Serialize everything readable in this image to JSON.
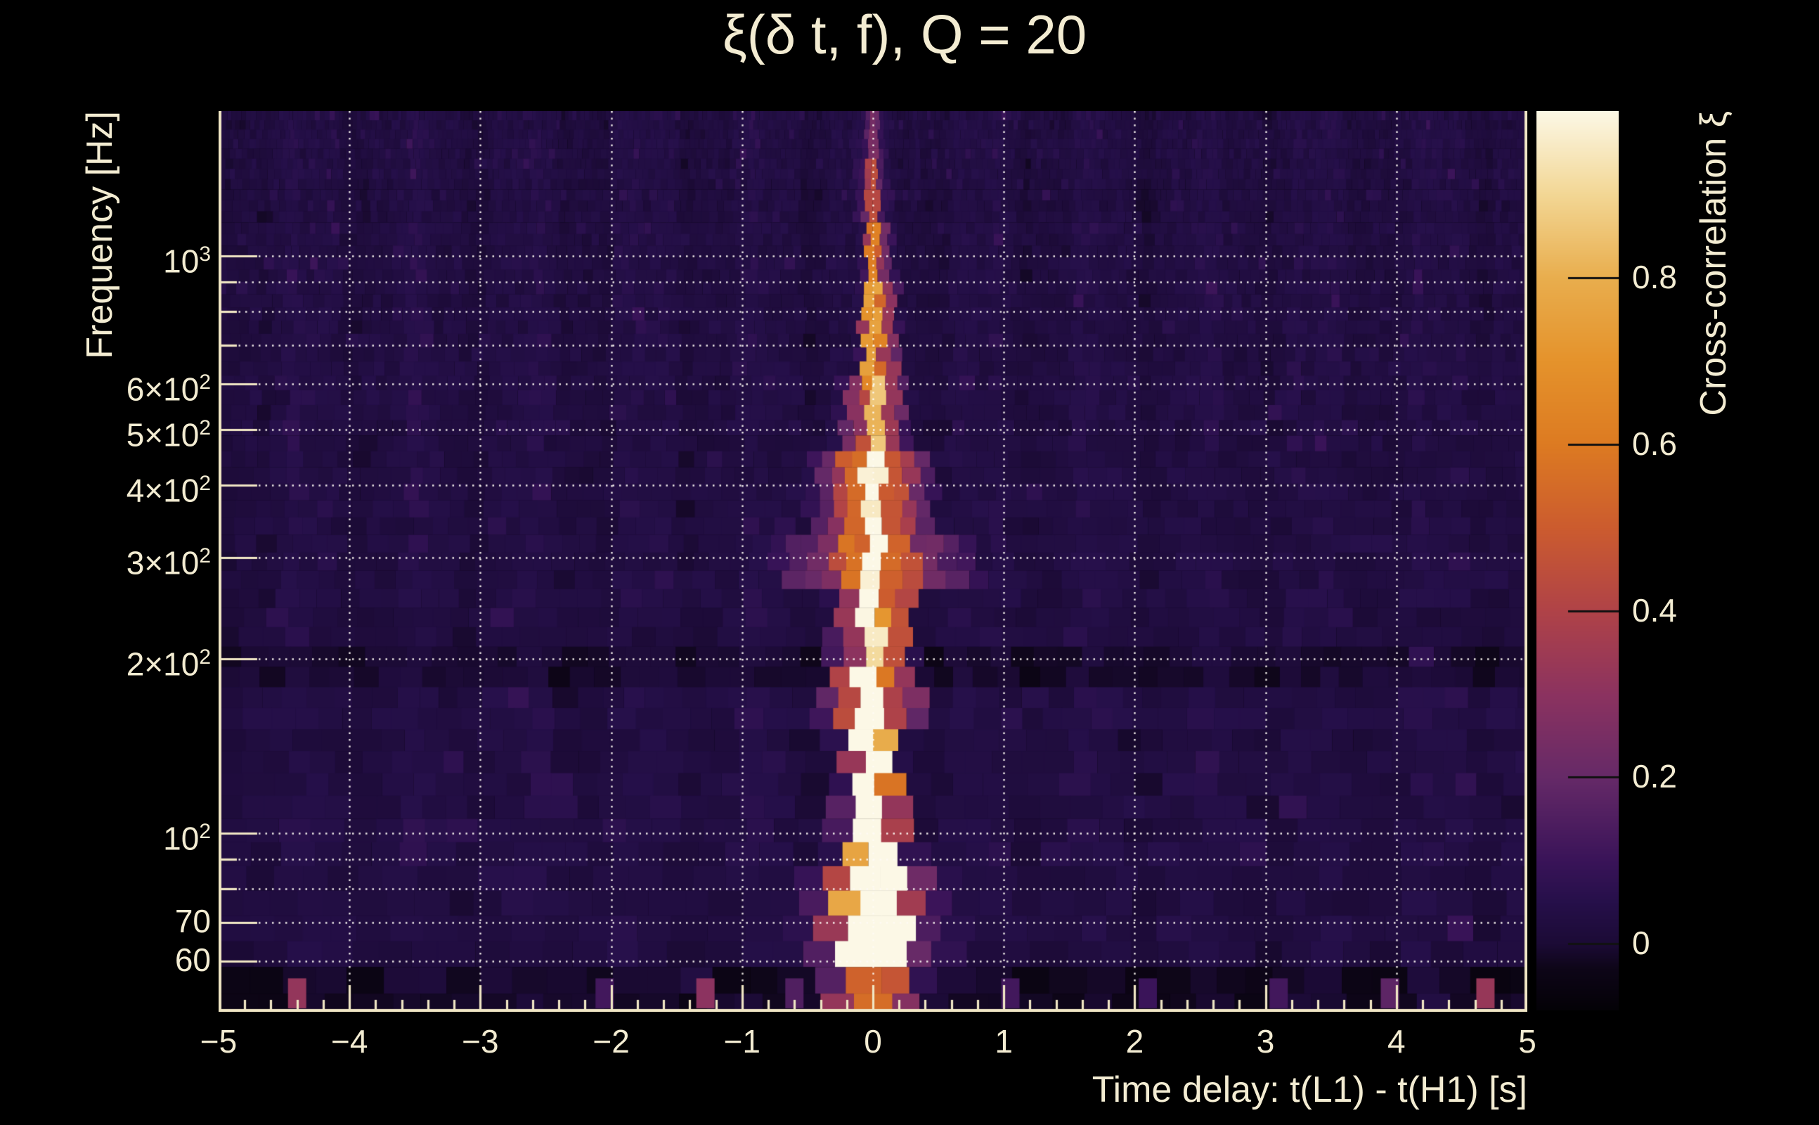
{
  "chart_data": {
    "type": "heatmap",
    "title": "ξ(δ t, f), Q = 20",
    "xlabel": "Time delay: t(L1) - t(H1) [s]",
    "ylabel": "Frequency [Hz]",
    "x_axis": {
      "min": -5,
      "max": 5,
      "major_ticks": [
        -5,
        -4,
        -3,
        -2,
        -1,
        0,
        1,
        2,
        3,
        4,
        5
      ],
      "major_tick_labels": [
        "−5",
        "−4",
        "−3",
        "−2",
        "−1",
        "0",
        "1",
        "2",
        "3",
        "4",
        "5"
      ],
      "minor_tick_step": 0.2,
      "gridlines": [
        -5,
        -4,
        -3,
        -2,
        -1,
        0,
        1,
        2,
        3,
        4,
        5
      ]
    },
    "y_axis": {
      "scale": "log",
      "min_hz": 49,
      "max_hz": 1780,
      "gridlines_hz": [
        1000,
        900,
        800,
        700,
        600,
        500,
        400,
        300,
        200,
        100,
        90,
        80,
        70,
        60
      ],
      "labeled_ticks_hz": [
        1000,
        600,
        500,
        400,
        300,
        200,
        100,
        70,
        60
      ],
      "tick_labels": [
        {
          "hz": 1000,
          "mantissa": "10",
          "exponent": "3"
        },
        {
          "hz": 600,
          "mantissa": "6×10",
          "exponent": "2"
        },
        {
          "hz": 500,
          "mantissa": "5×10",
          "exponent": "2"
        },
        {
          "hz": 400,
          "mantissa": "4×10",
          "exponent": "2"
        },
        {
          "hz": 300,
          "mantissa": "3×10",
          "exponent": "2"
        },
        {
          "hz": 200,
          "mantissa": "2×10",
          "exponent": "2"
        },
        {
          "hz": 100,
          "mantissa": "10",
          "exponent": "2"
        },
        {
          "hz": 70,
          "mantissa": "70",
          "exponent": ""
        },
        {
          "hz": 60,
          "mantissa": "60",
          "exponent": ""
        }
      ]
    },
    "colorbar": {
      "label": "Cross-correlation ξ",
      "vmin": -0.08,
      "vmax": 1.0,
      "ticks": [
        {
          "value": 0.8,
          "label": "0.8"
        },
        {
          "value": 0.6,
          "label": "0.6"
        },
        {
          "value": 0.4,
          "label": "0.4"
        },
        {
          "value": 0.2,
          "label": "0.2"
        },
        {
          "value": 0.0,
          "label": "0"
        }
      ]
    },
    "palette": [
      {
        "v": -0.08,
        "c": "#040207"
      },
      {
        "v": -0.03,
        "c": "#0e0618"
      },
      {
        "v": 0.0,
        "c": "#1c0b36"
      },
      {
        "v": 0.05,
        "c": "#26104a"
      },
      {
        "v": 0.1,
        "c": "#3a1459"
      },
      {
        "v": 0.2,
        "c": "#662a68"
      },
      {
        "v": 0.3,
        "c": "#8c3360"
      },
      {
        "v": 0.4,
        "c": "#b04348"
      },
      {
        "v": 0.5,
        "c": "#cc5c2f"
      },
      {
        "v": 0.6,
        "c": "#dd7b22"
      },
      {
        "v": 0.7,
        "c": "#e5932c"
      },
      {
        "v": 0.8,
        "c": "#e9ae4e"
      },
      {
        "v": 0.9,
        "c": "#f3d795"
      },
      {
        "v": 1.0,
        "c": "#fcf8e6"
      }
    ],
    "signal": {
      "peak_delay_s": 0.0,
      "peak_xi": 1.0,
      "ridge_bands": [
        {
          "f": [
            49,
            58
          ],
          "amp": 0.55,
          "mu": 0.0,
          "sigma": 0.16,
          "lobes": []
        },
        {
          "f": [
            58,
            88
          ],
          "amp": 1.0,
          "mu": 0.0,
          "sigma": 0.085,
          "lobes": [
            {
              "dt": 0.0,
              "a": 0.45,
              "s": 0.22
            }
          ]
        },
        {
          "f": [
            88,
            115
          ],
          "amp": 1.0,
          "mu": 0.0,
          "sigma": 0.045,
          "lobes": [
            {
              "dt": 0.0,
              "a": 0.25,
              "s": 0.12
            }
          ]
        },
        {
          "f": [
            115,
            150
          ],
          "amp": 0.85,
          "mu": -0.01,
          "sigma": 0.035,
          "lobes": [
            {
              "dt": 0.0,
              "a": 0.2,
              "s": 0.1
            }
          ]
        },
        {
          "f": [
            150,
            200
          ],
          "amp": 0.9,
          "mu": 0.005,
          "sigma": 0.03,
          "lobes": [
            {
              "dt": -0.22,
              "a": 0.35,
              "s": 0.05
            },
            {
              "dt": 0.2,
              "a": 0.3,
              "s": 0.05
            },
            {
              "dt": 0.0,
              "a": 0.15,
              "s": 0.14
            }
          ]
        },
        {
          "f": [
            200,
            260
          ],
          "amp": 0.95,
          "mu": 0.0,
          "sigma": 0.03,
          "lobes": [
            {
              "dt": 0.16,
              "a": 0.45,
              "s": 0.05
            },
            {
              "dt": -0.17,
              "a": 0.3,
              "s": 0.05
            }
          ]
        },
        {
          "f": [
            260,
            330
          ],
          "amp": 0.95,
          "mu": 0.02,
          "sigma": 0.035,
          "lobes": [
            {
              "dt": -0.18,
              "a": 0.55,
              "s": 0.06
            },
            {
              "dt": 0.18,
              "a": 0.5,
              "s": 0.06
            },
            {
              "dt": -0.38,
              "a": 0.2,
              "s": 0.05
            },
            {
              "dt": 0.38,
              "a": 0.18,
              "s": 0.05
            },
            {
              "dt": -0.55,
              "a": 0.12,
              "s": 0.1
            },
            {
              "dt": 0.55,
              "a": 0.12,
              "s": 0.1
            }
          ]
        },
        {
          "f": [
            330,
            450
          ],
          "amp": 0.9,
          "mu": 0.0,
          "sigma": 0.04,
          "lobes": [
            {
              "dt": -0.15,
              "a": 0.5,
              "s": 0.07
            },
            {
              "dt": 0.17,
              "a": 0.45,
              "s": 0.07
            },
            {
              "dt": -0.35,
              "a": 0.15,
              "s": 0.05
            },
            {
              "dt": 0.35,
              "a": 0.15,
              "s": 0.05
            }
          ]
        },
        {
          "f": [
            450,
            620
          ],
          "amp": 0.8,
          "mu": 0.01,
          "sigma": 0.03,
          "lobes": [
            {
              "dt": 0.12,
              "a": 0.3,
              "s": 0.05
            },
            {
              "dt": -0.12,
              "a": 0.25,
              "s": 0.05
            }
          ]
        },
        {
          "f": [
            620,
            900
          ],
          "amp": 0.7,
          "mu": -0.005,
          "sigma": 0.025,
          "lobes": [
            {
              "dt": 0.1,
              "a": 0.3,
              "s": 0.04
            }
          ]
        },
        {
          "f": [
            900,
            1150
          ],
          "amp": 0.55,
          "mu": 0.0,
          "sigma": 0.02,
          "lobes": [
            {
              "dt": 0.07,
              "a": 0.2,
              "s": 0.035
            }
          ]
        },
        {
          "f": [
            1150,
            1450
          ],
          "amp": 0.3,
          "mu": -0.005,
          "sigma": 0.018,
          "lobes": [
            {
              "dt": 0.0,
              "a": 0.1,
              "s": 0.06
            }
          ]
        },
        {
          "f": [
            1450,
            1800
          ],
          "amp": 0.15,
          "mu": 0.0,
          "sigma": 0.018,
          "lobes": [
            {
              "dt": 0.0,
              "a": 0.05,
              "s": 0.06
            }
          ]
        }
      ]
    },
    "noise": {
      "seed": 170817,
      "base": 0.03,
      "tile_sigma": 0.035,
      "column_amp": 0.013,
      "streak_prob": 0.06,
      "dark_band_hz": [
        183,
        208
      ],
      "bottom_dark_band_hz": 56
    },
    "bottom_row_features": [
      {
        "dt": -4.4,
        "xi": 0.32
      },
      {
        "dt": -2.05,
        "xi": 0.12
      },
      {
        "dt": -1.28,
        "xi": 0.3
      },
      {
        "dt": -0.6,
        "xi": 0.15
      },
      {
        "dt": 1.05,
        "xi": 0.12
      },
      {
        "dt": 2.1,
        "xi": 0.1
      },
      {
        "dt": 3.1,
        "xi": 0.12
      },
      {
        "dt": 3.95,
        "xi": 0.18
      },
      {
        "dt": 4.68,
        "xi": 0.33
      }
    ]
  },
  "style": {
    "background": "#000000",
    "text_color": "#f3ecd2",
    "axis_color": "#f0e6c4",
    "gridline_color": "rgba(255,252,245,0.92)"
  }
}
